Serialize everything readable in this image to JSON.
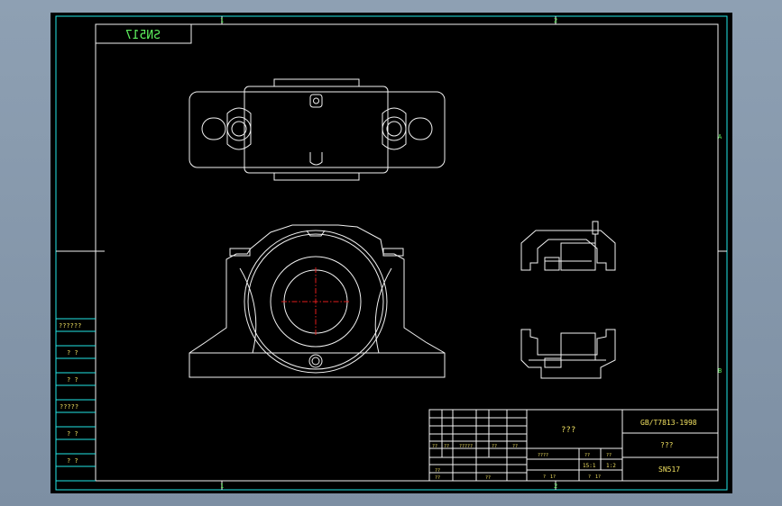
{
  "drawing": {
    "model_label": "SN517",
    "zone_marks": {
      "top_1": "1",
      "top_2": "2",
      "bottom_1": "1",
      "bottom_2": "2",
      "right_a": "A",
      "right_b": "B"
    }
  },
  "left_strip": {
    "labels": [
      "??????",
      "? ?",
      "? ?",
      "?????",
      "? ?",
      "? ?"
    ]
  },
  "title_block": {
    "title_center": "???",
    "standard": "GB/T7813-1998",
    "material": "???",
    "part_name": "SN517",
    "sign_row": [
      "??",
      "??",
      "?????",
      "??",
      "??"
    ],
    "left_rows": [
      "??",
      "??",
      "??"
    ],
    "left_row_mid": "??",
    "scale_header": [
      "????",
      "??",
      "??"
    ],
    "scale_values": [
      "15:1",
      "1:2"
    ],
    "sheet_row": [
      "?",
      "1?",
      "?",
      "1?"
    ]
  }
}
